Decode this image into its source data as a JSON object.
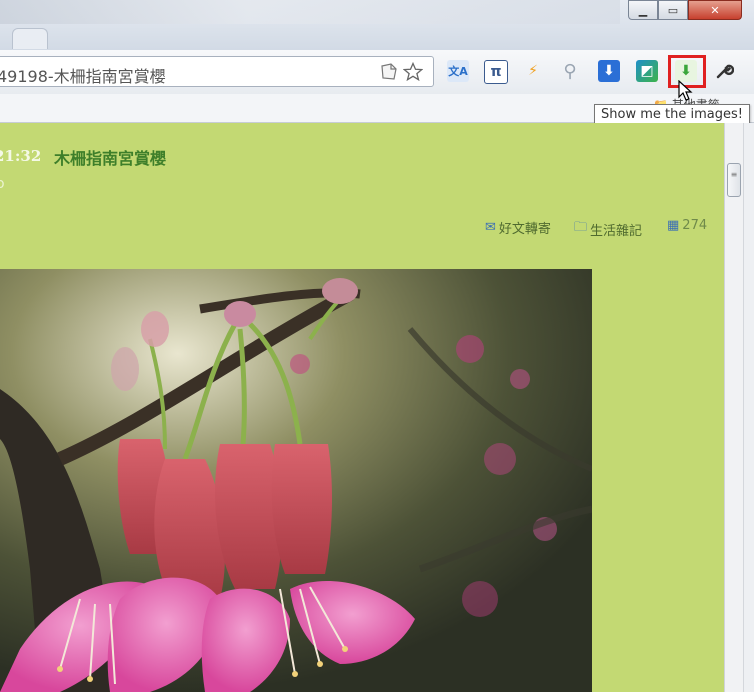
{
  "window": {
    "controls": {
      "minimize": "▁",
      "maximize": "▭",
      "close": "✕"
    }
  },
  "toolbar": {
    "url": "49198-木柵指南宮賞櫻",
    "bookmark_page_icon": "page-icon",
    "star_icon": "star-icon",
    "extensions": [
      {
        "name": "translate-extension-icon",
        "glyph": "文A",
        "color": "#2a6fc9"
      },
      {
        "name": "pi-extension-icon",
        "glyph": "π",
        "color": "#3b5b8f"
      },
      {
        "name": "lightning-extension-icon",
        "glyph": "⚡",
        "color": "#f0a020"
      },
      {
        "name": "search-extension-icon",
        "glyph": "⚲",
        "color": "#9aa5b2"
      },
      {
        "name": "download-extension-icon",
        "glyph": "⬇",
        "color": "#2b6fd6"
      },
      {
        "name": "photo-extension-icon",
        "glyph": "◩",
        "color": "#1f8fc9"
      },
      {
        "name": "show-images-extension-icon",
        "glyph": "⬇",
        "color": "#3aa63a"
      },
      {
        "name": "wrench-icon",
        "glyph": "🔧",
        "color": "#444444"
      }
    ],
    "tooltip": "Show me the images!"
  },
  "bookmarks": {
    "folder_label": "其他書籤"
  },
  "post": {
    "time": "21:32",
    "title": "木柵指南宮賞櫻",
    "subtitle": "o",
    "share_label": "好文轉寄",
    "category_label": "生活雜記",
    "views": "274"
  },
  "colors": {
    "page_background": "#c3d973",
    "title_color": "#3e7f2a",
    "highlight": "#e02020"
  }
}
